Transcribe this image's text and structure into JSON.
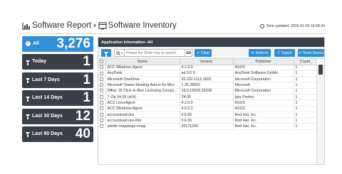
{
  "breadcrumb": {
    "root": "Software Report",
    "current": "Software Inventory"
  },
  "updated": "Time updated: 2026-01-09 15:58:34",
  "tiles": [
    {
      "label": "All",
      "count": "3,276",
      "active": true
    },
    {
      "label": "Today",
      "count": "1"
    },
    {
      "label": "Last 7 Days",
      "count": "1"
    },
    {
      "label": "Last 14 Days",
      "count": "1"
    },
    {
      "label": "Last 30 Days",
      "count": "12"
    },
    {
      "label": "Last 90 Days",
      "count": "40"
    }
  ],
  "panel": {
    "title": "Application Information -All",
    "search_placeholder": "Please the 'Enter' key to search.",
    "clear": "Clear",
    "refresh": "Refresh",
    "export": "Export",
    "show_device": "Show Device"
  },
  "columns": [
    "Name",
    "Version",
    "Publisher",
    "Count"
  ],
  "rows": [
    [
      "ACC Windows Agent",
      "4.1.0.0",
      "ASUS",
      "1"
    ],
    [
      "AnyDesk",
      "ad 9.0.9",
      "AnyDesk Software GmbH",
      "1"
    ],
    [
      "Microsoft OneDrive",
      "25.222.1112.0002",
      "Microsoft Corporation",
      "1"
    ],
    [
      "Microsoft Teams Meeting Add-in for Micr...",
      "1.25.28902",
      "Microsoft",
      "1"
    ],
    [
      "Office 16 Click-to-Run Licensing Compo...",
      "16.0.19029.20208",
      "Microsoft Corporation",
      "1"
    ],
    [
      "7-Zip 24.09 (x64)",
      "24.09",
      "Igor Pavlov",
      "1"
    ],
    [
      "ACC LinuxAgent",
      "4.1.0.0",
      "ASUS",
      "1"
    ],
    [
      "ACC Windows Agent",
      "4.0.0.2",
      "ASUS",
      "1"
    ],
    [
      "accountsservice",
      "0.6.55",
      "Red Hat, Inc.",
      "1"
    ],
    [
      "accountsservice-libs",
      "0.6.55",
      "Red Hat, Inc.",
      "1"
    ],
    [
      "adobe-mappings-cmap",
      "20171205",
      "Red Hat, Inc.",
      "1"
    ]
  ],
  "colors": {
    "accent": "#2f8ed4",
    "dark": "#3a3f48"
  }
}
